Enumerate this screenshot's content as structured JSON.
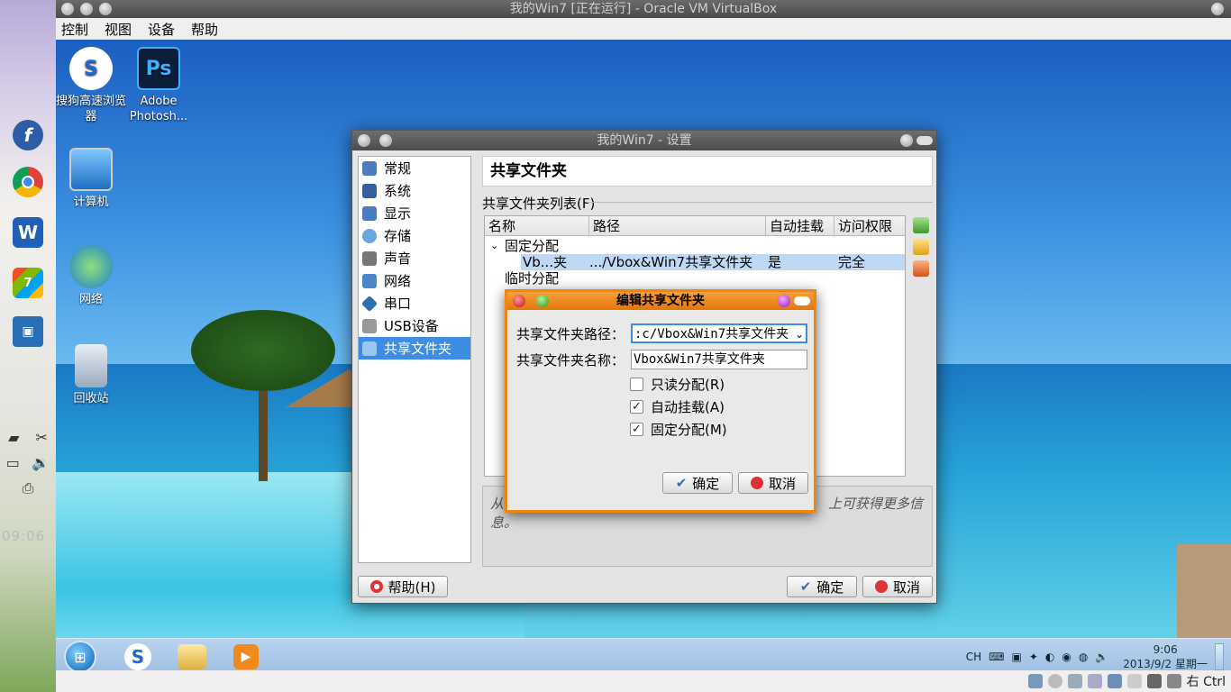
{
  "vbox": {
    "title": "我的Win7 [正在运行] - Oracle VM VirtualBox",
    "menu": [
      "控制",
      "视图",
      "设备",
      "帮助"
    ],
    "status_host_key": "右 Ctrl"
  },
  "desktop": {
    "icons": [
      {
        "label": "搜狗高速浏览器"
      },
      {
        "label": "Adobe Photosh..."
      },
      {
        "label": "计算机"
      },
      {
        "label": "网络"
      },
      {
        "label": "回收站"
      }
    ]
  },
  "taskbar": {
    "tray_lang": "CH",
    "time": "9:06",
    "date": "2013/9/2 星期一"
  },
  "host": {
    "clock": "09:06"
  },
  "settings": {
    "title": "我的Win7 - 设置",
    "nav": [
      "常规",
      "系统",
      "显示",
      "存储",
      "声音",
      "网络",
      "串口",
      "USB设备",
      "共享文件夹"
    ],
    "page_title": "共享文件夹",
    "list_label": "共享文件夹列表(F)",
    "columns": [
      "名称",
      "路径",
      "自动挂载",
      "访问权限"
    ],
    "groups": {
      "fixed": "固定分配",
      "temp": "临时分配"
    },
    "row": {
      "name": "Vb...夹",
      "path": ".../Vbox&Win7共享文件夹",
      "automount": "是",
      "access": "完全"
    },
    "description": "从左侧选择一个设置分类，将鼠标移到一个设置项上可获得更多信息。",
    "description_visible_start": "从",
    "description_visible_end": "上可获得更多信",
    "description_line2": "息。",
    "help_button": "帮助(H)",
    "ok_button": "确定",
    "cancel_button": "取消"
  },
  "edit_dialog": {
    "title": "编辑共享文件夹",
    "path_label": "共享文件夹路径：",
    "path_value": ":c/Vbox&Win7共享文件夹",
    "name_label": "共享文件夹名称：",
    "name_value": "Vbox&Win7共享文件夹",
    "readonly_label": "只读分配(R)",
    "automount_label": "自动挂载(A)",
    "permanent_label": "固定分配(M)",
    "readonly_checked": false,
    "automount_checked": true,
    "permanent_checked": true,
    "ok_button": "确定",
    "cancel_button": "取消"
  },
  "colors": {
    "accent_select": "#3d8ee3",
    "dialog_border": "#f0860d"
  }
}
